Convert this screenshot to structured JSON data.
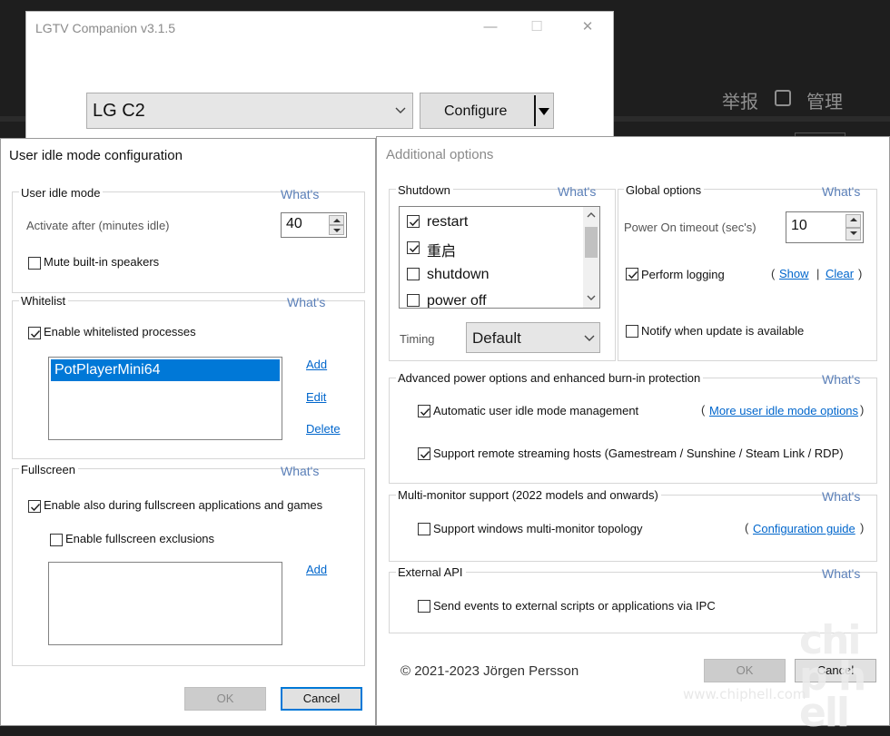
{
  "background_page": {
    "report_label": "举报",
    "manage_label": "管理"
  },
  "main_window": {
    "title": "LGTV Companion v3.1.5",
    "controls": {
      "minimize": "—",
      "maximize": "☐",
      "close": "✕"
    },
    "device_select": "LG C2",
    "configure_label": "Configure"
  },
  "idle_dialog": {
    "title": "User idle mode configuration",
    "user_idle": {
      "group": "User idle mode",
      "whats": "What's",
      "activate_label": "Activate after (minutes idle)",
      "activate_value": "40",
      "mute_label": "Mute built-in speakers",
      "mute_checked": false
    },
    "whitelist": {
      "group": "Whitelist",
      "whats": "What's",
      "enable_label": "Enable whitelisted processes",
      "enable_checked": true,
      "items": [
        "PotPlayerMini64"
      ],
      "add": "Add",
      "edit": "Edit",
      "delete": "Delete"
    },
    "fullscreen": {
      "group": "Fullscreen",
      "whats": "What's",
      "enable_label": "Enable also during fullscreen applications and games",
      "enable_checked": true,
      "exclusions_label": "Enable fullscreen exclusions",
      "exclusions_checked": false,
      "add": "Add"
    },
    "ok": "OK",
    "cancel": "Cancel"
  },
  "options_dialog": {
    "title": "Additional options",
    "shutdown": {
      "group": "Shutdown",
      "whats": "What's",
      "items": [
        {
          "label": "restart",
          "checked": true
        },
        {
          "label": "重启",
          "checked": true
        },
        {
          "label": "shutdown",
          "checked": false
        },
        {
          "label": "power off",
          "checked": false
        }
      ],
      "timing_label": "Timing",
      "timing_value": "Default"
    },
    "global": {
      "group": "Global options",
      "whats": "What's",
      "timeout_label": "Power On timeout (sec's)",
      "timeout_value": "10",
      "logging_label": "Perform logging",
      "logging_checked": true,
      "show": "Show",
      "clear": "Clear",
      "notify_label": "Notify when update is available",
      "notify_checked": false
    },
    "advanced": {
      "group": "Advanced power options and enhanced burn-in protection",
      "whats": "What's",
      "idle_mgmt_label": "Automatic user idle mode management",
      "idle_mgmt_checked": true,
      "more_link": "More user idle mode options",
      "streaming_label": "Support remote streaming hosts (Gamestream / Sunshine / Steam Link / RDP)",
      "streaming_checked": true
    },
    "multimonitor": {
      "group": "Multi-monitor support (2022 models and onwards)",
      "whats": "What's",
      "topology_label": "Support windows multi-monitor topology",
      "topology_checked": false,
      "guide_link": "Configuration guide"
    },
    "external_api": {
      "group": "External API",
      "whats": "What's",
      "ipc_label": "Send events to external scripts or applications via IPC",
      "ipc_checked": false
    },
    "copyright": "© 2021-2023 Jörgen Persson",
    "ok": "OK",
    "cancel": "Cancel"
  },
  "watermark": {
    "url": "www.chiphell.com",
    "logo": "chip hell"
  }
}
